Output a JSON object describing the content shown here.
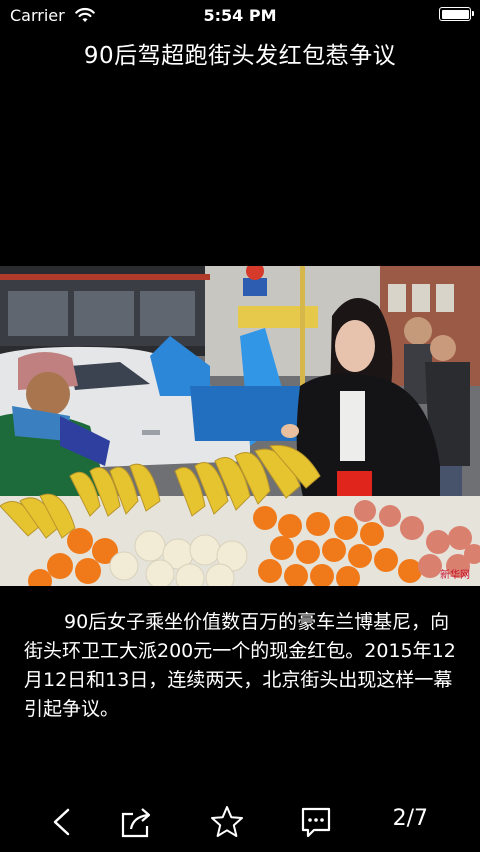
{
  "status_bar": {
    "carrier": "Carrier",
    "time": "5:54 PM",
    "battery_level": 1.0
  },
  "article": {
    "title": "90后驾超跑街头发红包惹争议",
    "image": {
      "watermark": "新华网",
      "description_icon": "photo"
    },
    "caption": "90后女子乘坐价值数百万的豪车兰博基尼，向街头环卫工大派200元一个的现金红包。2015年12月12日和13日，连续两天，北京街头出现这样一幕引起争议。"
  },
  "toolbar": {
    "back_icon": "chevron-left-icon",
    "share_icon": "share-icon",
    "favorite_icon": "star-icon",
    "comment_icon": "comment-icon",
    "page_counter": "2/7"
  }
}
